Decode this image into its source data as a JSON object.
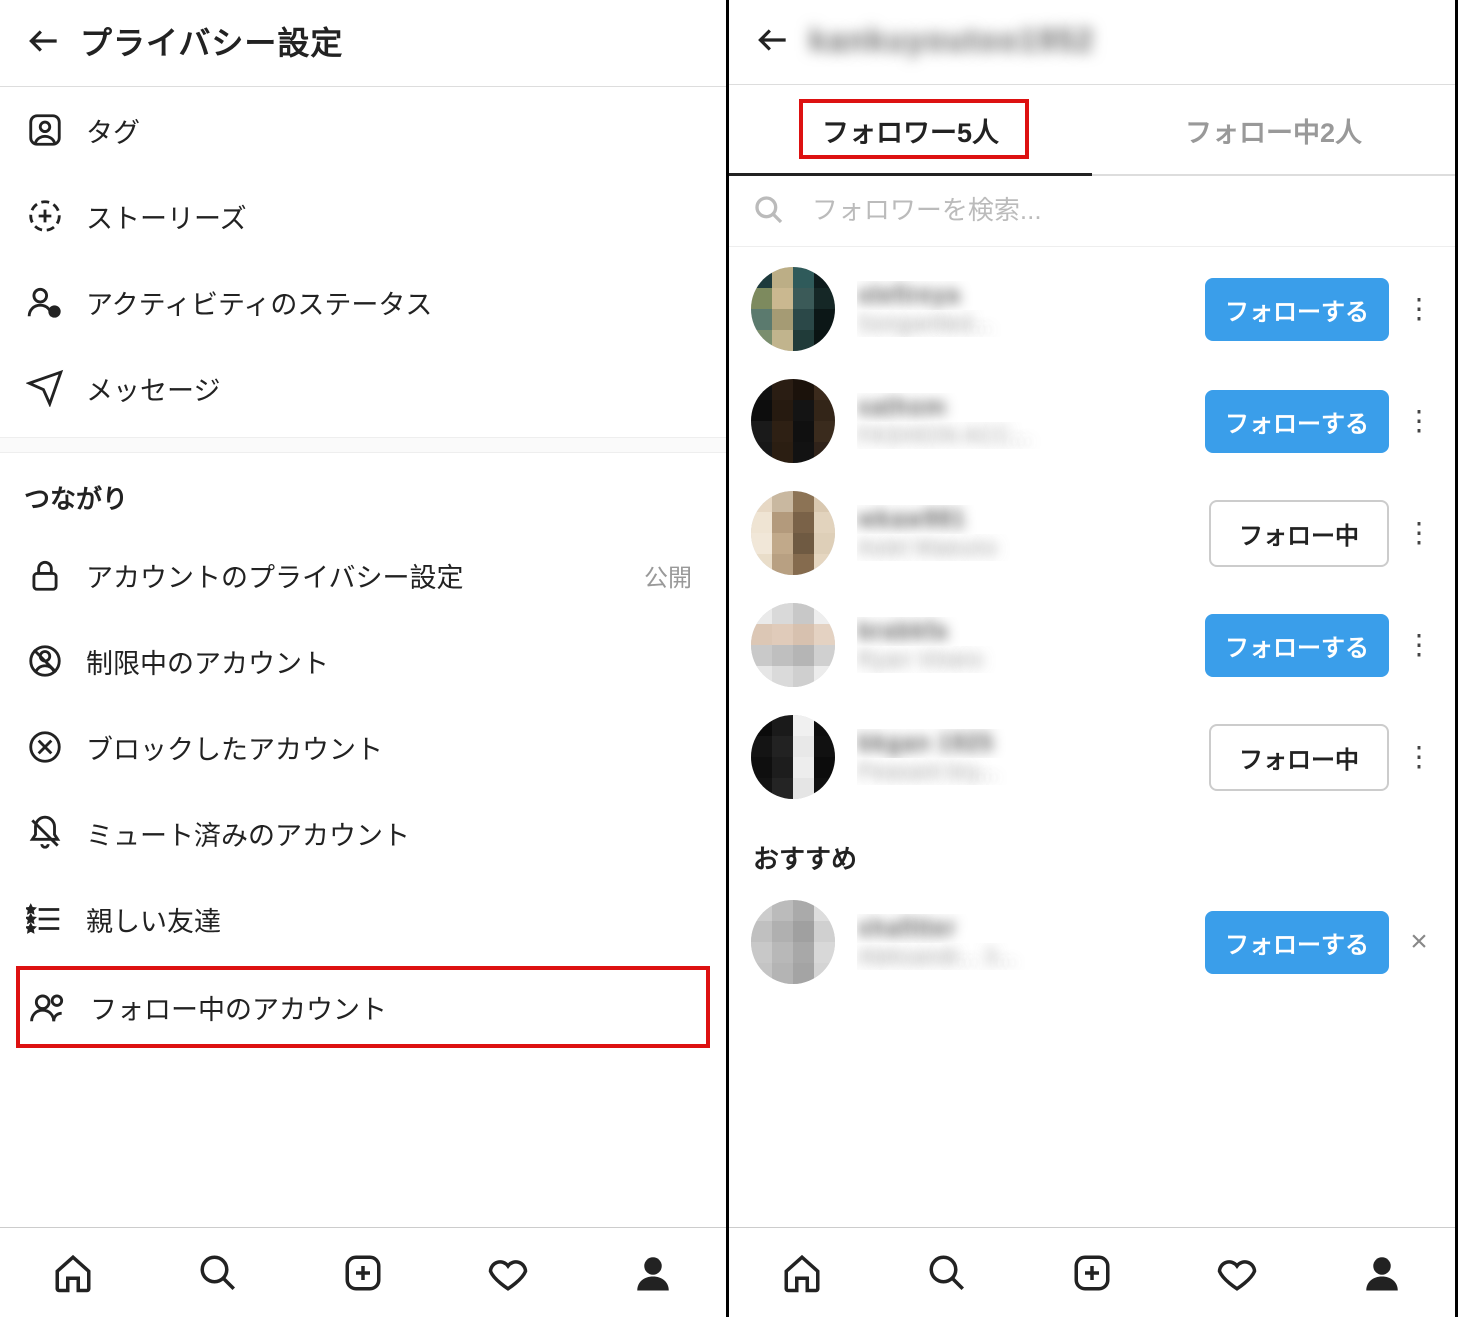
{
  "left": {
    "header": {
      "title": "プライバシー設定"
    },
    "section1": [
      {
        "icon": "tag-user-icon",
        "label": "タグ"
      },
      {
        "icon": "story-add-icon",
        "label": "ストーリーズ"
      },
      {
        "icon": "activity-status-icon",
        "label": "アクティビティのステータス"
      },
      {
        "icon": "paper-plane-icon",
        "label": "メッセージ"
      }
    ],
    "section2_header": "つながり",
    "section2": [
      {
        "icon": "lock-icon",
        "label": "アカウントのプライバシー設定",
        "trail": "公開"
      },
      {
        "icon": "restrict-icon",
        "label": "制限中のアカウント"
      },
      {
        "icon": "block-x-icon",
        "label": "ブロックしたアカウント"
      },
      {
        "icon": "bell-mute-icon",
        "label": "ミュート済みのアカウント"
      },
      {
        "icon": "star-list-icon",
        "label": "親しい友達"
      }
    ],
    "highlight": {
      "icon": "people-icon",
      "label": "フォロー中のアカウント"
    }
  },
  "right": {
    "header": {
      "username_obscured": "kankuyoutoo1952"
    },
    "tabs": {
      "followers": "フォロワー5人",
      "following": "フォロー中2人"
    },
    "search": {
      "placeholder": "フォロワーを検索..."
    },
    "followers": [
      {
        "username": "olefireya",
        "display": "Songwrited...",
        "btn": "follow",
        "btn_label": "フォローする",
        "colors": [
          "#1d3a3c",
          "#bcae86",
          "#2f5a5a",
          "#0e1b1c",
          "#7d8a5e",
          "#cab890",
          "#3b5a58",
          "#152726",
          "#5b7a6e",
          "#a59b74",
          "#2b4848",
          "#0c1717",
          "#7a8e6e",
          "#c1b48d",
          "#203b39",
          "#0a1413"
        ]
      },
      {
        "username": "sathom",
        "display": "FASHION ACC...",
        "btn": "follow",
        "btn_label": "フォローする",
        "colors": [
          "#111",
          "#2a1d13",
          "#1b120b",
          "#3b2a1c",
          "#0d0d0d",
          "#261a10",
          "#141414",
          "#332518",
          "#1a1a1a",
          "#2e2014",
          "#101010",
          "#3a2b1d",
          "#171717",
          "#2b1e12",
          "#121212",
          "#30231a"
        ]
      },
      {
        "username": "wkaw981",
        "display": "Aviet Maeuno",
        "btn": "following",
        "btn_label": "フォロー中",
        "colors": [
          "#e7d8c4",
          "#c9b8a0",
          "#8c7355",
          "#d9c8b0",
          "#efe4d3",
          "#b39a7c",
          "#7a6248",
          "#e2d3bd",
          "#f1e7d8",
          "#c1a98a",
          "#6f5a42",
          "#decfb8",
          "#e9ddc9",
          "#b8a082",
          "#856b4e",
          "#e5d6c0"
        ]
      },
      {
        "username": "brabkfa",
        "display": "Ryan Vinero",
        "btn": "follow",
        "btn_label": "フォローする",
        "colors": [
          "#eaeaea",
          "#d9d9d9",
          "#c8c8c8",
          "#eee",
          "#dcc7b5",
          "#e0cbba",
          "#d7c1af",
          "#e4d2c2",
          "#c9c9c9",
          "#bfbfbf",
          "#b5b5b5",
          "#d0d0d0",
          "#e6e6e6",
          "#dadada",
          "#cfcfcf",
          "#ececec"
        ]
      },
      {
        "username": "bkgan 1925",
        "display": "Peasant bry...",
        "btn": "following",
        "btn_label": "フォロー中",
        "colors": [
          "#0b0b0b",
          "#1a1a1a",
          "#f0f0f0",
          "#0e0e0e",
          "#141414",
          "#222",
          "#e8e8e8",
          "#111",
          "#0f0f0f",
          "#1d1d1d",
          "#ededed",
          "#0c0c0c",
          "#131313",
          "#242424",
          "#e5e5e5",
          "#101010"
        ]
      }
    ],
    "suggestions_header": "おすすめ",
    "suggestions": [
      {
        "username": "shafitter",
        "display": "Aleksandr... 3...",
        "btn": "follow",
        "btn_label": "フォローする",
        "colors": [
          "#ccc",
          "#bbb",
          "#aaa",
          "#ddd",
          "#c0c0c0",
          "#b0b0b0",
          "#a0a0a0",
          "#d0d0d0",
          "#c8c8c8",
          "#b8b8b8",
          "#a8a8a8",
          "#d8d8d8",
          "#c4c4c4",
          "#b4b4b4",
          "#a4a4a4",
          "#d4d4d4"
        ]
      }
    ]
  },
  "buttons": {
    "follow": "フォローする",
    "following": "フォロー中"
  }
}
